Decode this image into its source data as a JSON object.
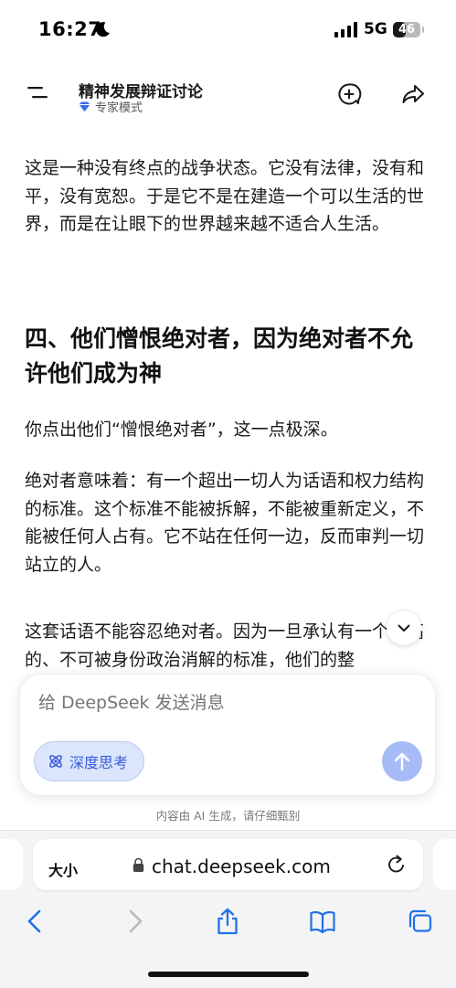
{
  "status_bar": {
    "time": "16:27",
    "network": "5G",
    "battery": "46",
    "battery_level": 0.46,
    "signal_bars": 4
  },
  "header": {
    "title": "精神发展辩证讨论",
    "mode": "专家模式",
    "icons": [
      "menu-icon",
      "new-chat-icon",
      "share-icon"
    ]
  },
  "article": {
    "paragraphs_top": [
      "这是一种没有终点的战争状态。它没有法律，没有和平，没有宽恕。于是它不是在建造一个可以生活的世界，而是在让眼下的世界越来越不适合人生活。"
    ],
    "heading": "四、他们憎恨绝对者，因为绝对者不允许他们成为神",
    "paragraphs": [
      "你点出他们“憎恨绝对者”，这一点极深。",
      "绝对者意味着：有一个超出一切人为话语和权力结构的标准。这个标准不能被拆解，不能被重新定义，不能被任何人占有。它不站在任何一边，反而审判一切站立的人。",
      "这套话语不能容忍绝对者。因为一旦承认有一个更高的、不可被身份政治消解的标准，他们的整"
    ]
  },
  "composer": {
    "placeholder": "给 DeepSeek 发送消息",
    "deep_think_label": "深度思考"
  },
  "disclaimer": "内容由 AI 生成，请仔细甄别",
  "browser": {
    "text_size_label": "大小",
    "url": "chat.deepseek.com"
  },
  "colors": {
    "accent": "#3b5bd9",
    "send_button": "#a7bcf6",
    "chip_bg": "#dbe5fb",
    "link_blue": "#1f72e8"
  }
}
